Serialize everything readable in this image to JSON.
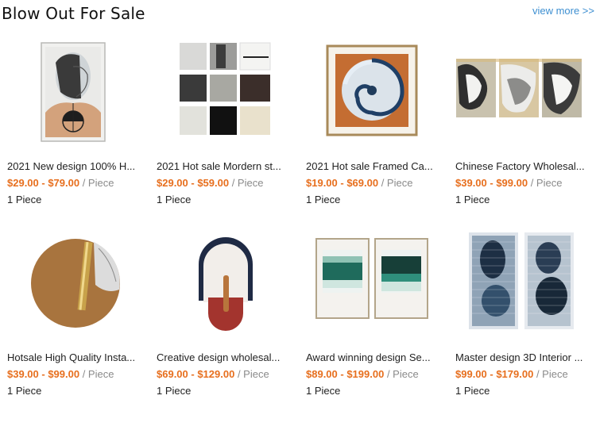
{
  "section": {
    "title": "Blow Out For Sale",
    "view_more": "view more >>"
  },
  "products": [
    {
      "name": "2021 New design 100% H...",
      "price": "$29.00 - $79.00",
      "unit": "/ Piece",
      "moq": "1 Piece",
      "image": "abstract-portrait-framed-art"
    },
    {
      "name": "2021 Hot sale Mordern st...",
      "price": "$29.00 - $59.00",
      "unit": "/ Piece",
      "moq": "1 Piece",
      "image": "textured-panel-set"
    },
    {
      "name": "2021 Hot sale Framed Ca...",
      "price": "$19.00 - $69.00",
      "unit": "/ Piece",
      "moq": "1 Piece",
      "image": "swirl-canvas-framed"
    },
    {
      "name": "Chinese Factory Wholesal...",
      "price": "$39.00 - $99.00",
      "unit": "/ Piece",
      "moq": "1 Piece",
      "image": "gold-marble-triptych"
    },
    {
      "name": "Hotsale High Quality Insta...",
      "price": "$39.00 - $99.00",
      "unit": "/ Piece",
      "moq": "1 Piece",
      "image": "round-leather-art"
    },
    {
      "name": "Creative design wholesal...",
      "price": "$69.00 - $129.00",
      "unit": "/ Piece",
      "moq": "1 Piece",
      "image": "arch-sculpture-art"
    },
    {
      "name": "Award winning design Se...",
      "price": "$89.00 - $199.00",
      "unit": "/ Piece",
      "moq": "1 Piece",
      "image": "green-gradient-diptych"
    },
    {
      "name": "Master design 3D Interior ...",
      "price": "$99.00 - $179.00",
      "unit": "/ Piece",
      "moq": "1 Piece",
      "image": "3d-acrylic-diptych"
    }
  ],
  "colors": {
    "price": "#e76f1e",
    "link": "#3d8fd1"
  }
}
